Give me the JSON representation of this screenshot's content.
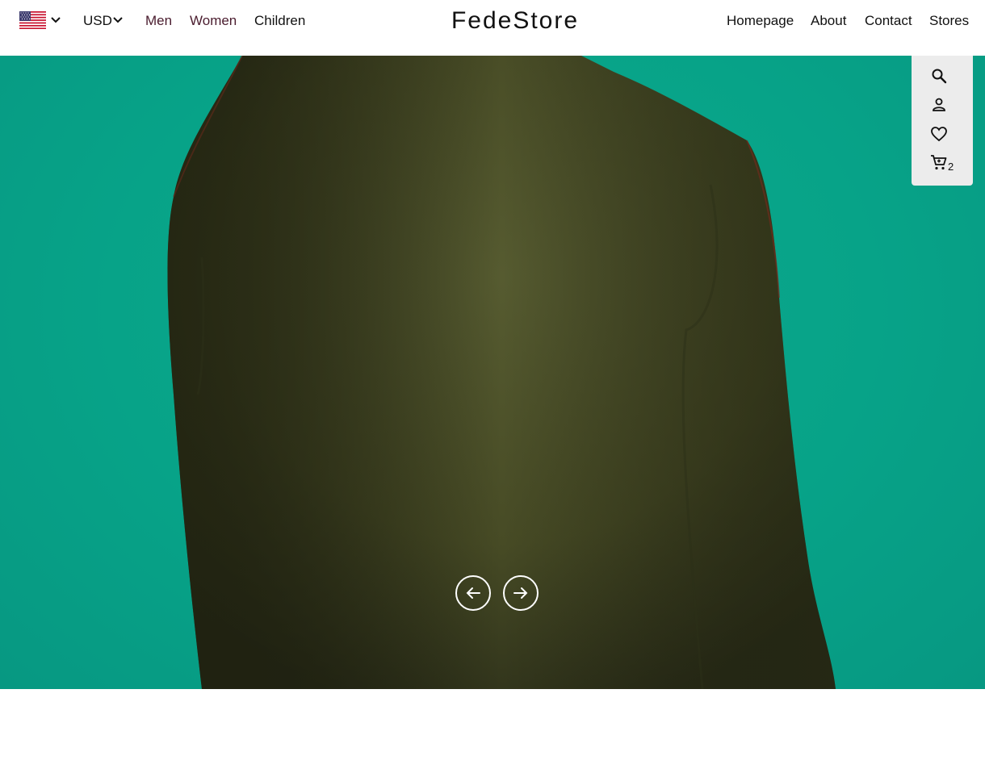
{
  "header": {
    "flag_icon": "us-flag-icon",
    "currency": "USD",
    "categories": [
      {
        "label": "Men",
        "color": "#4a1c2e"
      },
      {
        "label": "Women",
        "color": "#4a1c2e"
      },
      {
        "label": "Children",
        "color": "#111111"
      }
    ],
    "logo": "FedeStore",
    "nav": [
      {
        "label": "Homepage"
      },
      {
        "label": "About"
      },
      {
        "label": "Contact"
      },
      {
        "label": "Stores"
      }
    ]
  },
  "icons": {
    "search": "search-icon",
    "user": "user-icon",
    "wishlist": "heart-icon",
    "cart": "cart-icon",
    "cart_count": "2"
  },
  "slider": {
    "prev": "arrow-left-icon",
    "next": "arrow-right-icon"
  },
  "colors": {
    "accent": "#4a1c2e",
    "hero_background": "#07a388",
    "sweater": "#4b5027",
    "icon_panel": "#ececec"
  }
}
